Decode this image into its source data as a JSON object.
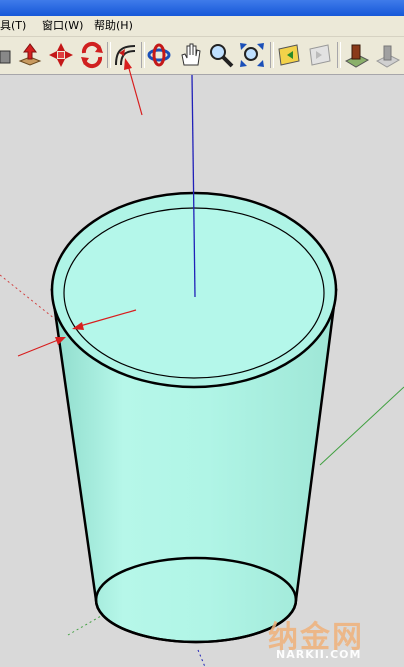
{
  "menu": {
    "tools": "具(T)",
    "window": "窗口(W)",
    "help": "帮助(H)"
  },
  "toolbar": {
    "tools": [
      "paint-bucket-icon",
      "push-pull-icon",
      "move-icon",
      "rotate-icon",
      "offset-icon",
      "orbit-icon",
      "pan-icon",
      "zoom-icon",
      "zoom-extents-icon",
      "previous-view-icon",
      "next-view-icon",
      "add-location-icon",
      "toggle-terrain-icon"
    ]
  },
  "colors": {
    "cylinder": "#aff4e6",
    "cylinder_shade": "#8dd8c8",
    "axis_blue": "#2020b8",
    "axis_red": "#d04040",
    "axis_green": "#40a040",
    "annotation_arrow": "#d81e1e",
    "viewport_bg": "#d9d9d9"
  },
  "watermark": {
    "logo": "纳金网",
    "url": "NARKII.COM"
  }
}
